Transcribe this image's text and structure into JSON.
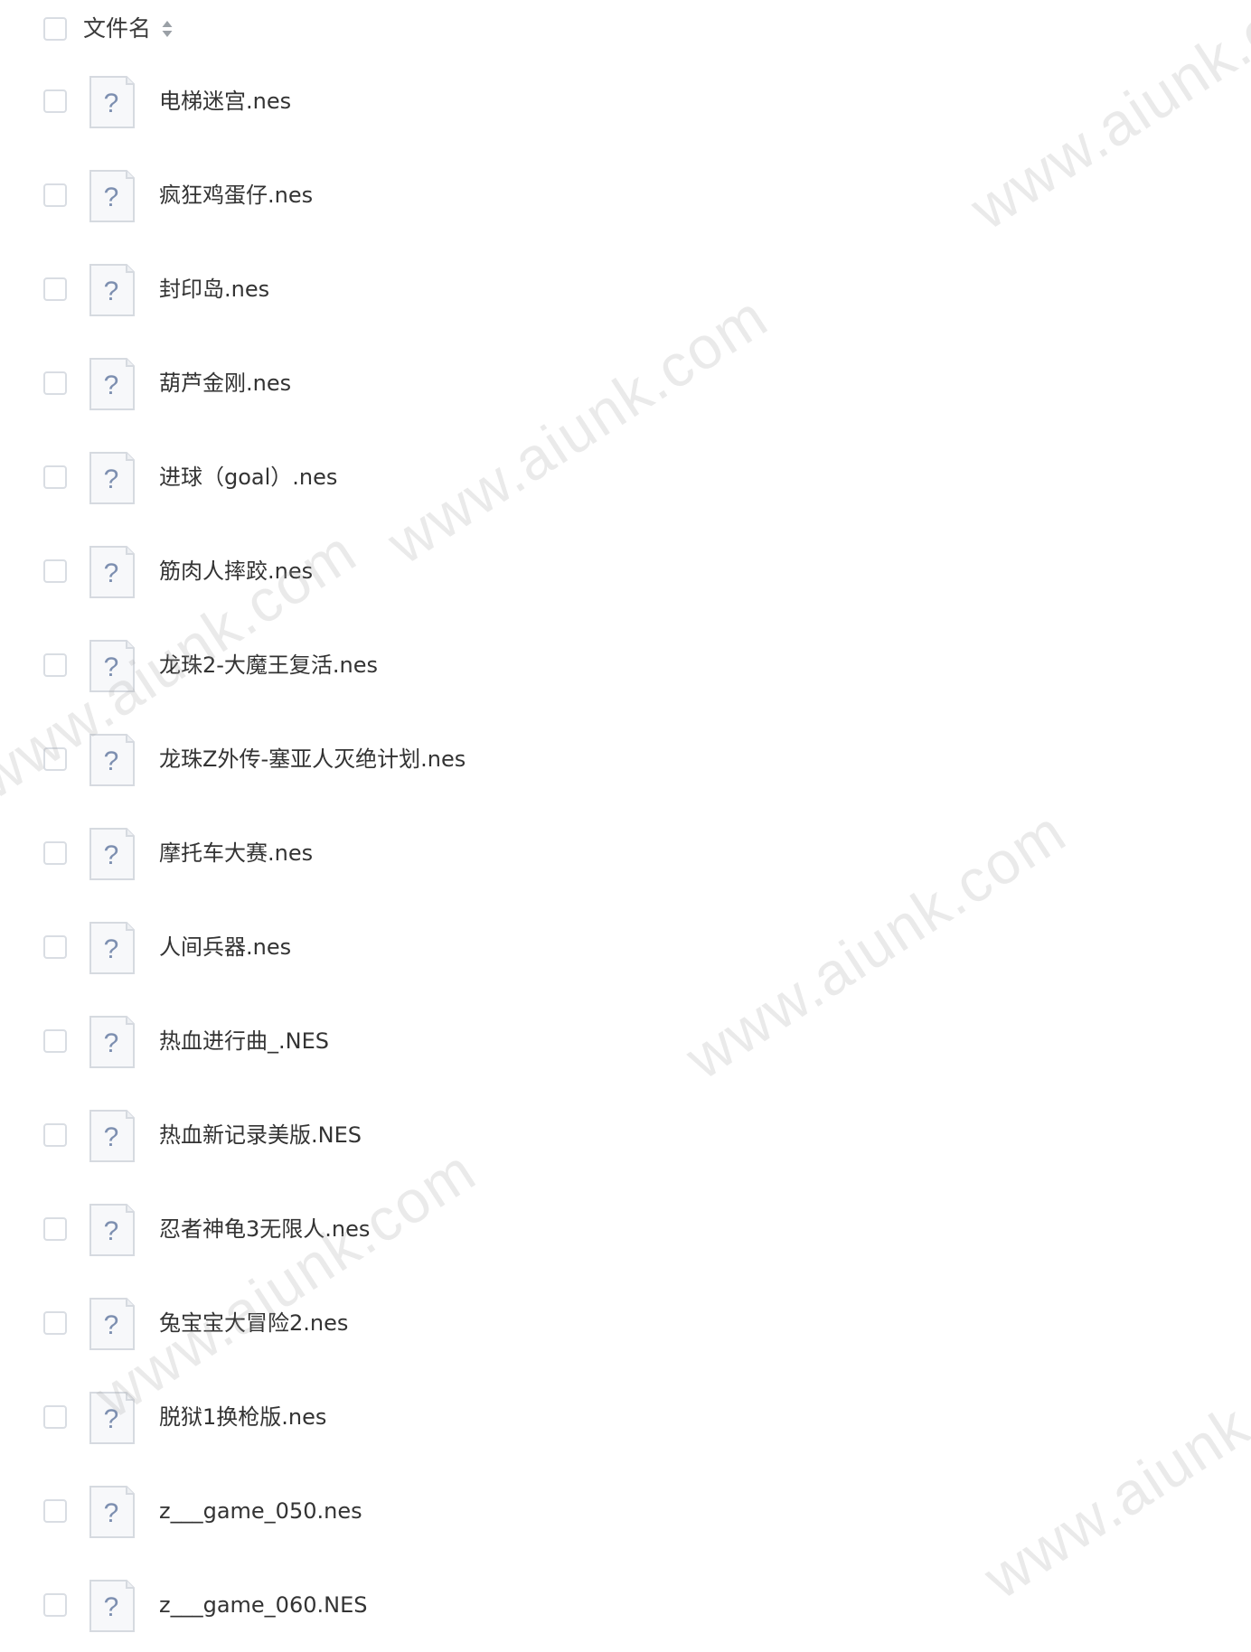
{
  "header": {
    "column_label": "文件名",
    "sort_icon": "sort-updown-icon"
  },
  "files": [
    {
      "name": "电梯迷宫.nes",
      "icon": "unknown-file-icon"
    },
    {
      "name": "疯狂鸡蛋仔.nes",
      "icon": "unknown-file-icon"
    },
    {
      "name": "封印岛.nes",
      "icon": "unknown-file-icon"
    },
    {
      "name": "葫芦金刚.nes",
      "icon": "unknown-file-icon"
    },
    {
      "name": "进球（goal）.nes",
      "icon": "unknown-file-icon"
    },
    {
      "name": "筋肉人摔跤.nes",
      "icon": "unknown-file-icon"
    },
    {
      "name": "龙珠2-大魔王复活.nes",
      "icon": "unknown-file-icon"
    },
    {
      "name": "龙珠Z外传-塞亚人灭绝计划.nes",
      "icon": "unknown-file-icon"
    },
    {
      "name": "摩托车大赛.nes",
      "icon": "unknown-file-icon"
    },
    {
      "name": "人间兵器.nes",
      "icon": "unknown-file-icon"
    },
    {
      "name": "热血进行曲_.NES",
      "icon": "unknown-file-icon"
    },
    {
      "name": "热血新记录美版.NES",
      "icon": "unknown-file-icon"
    },
    {
      "name": "忍者神龟3无限人.nes",
      "icon": "unknown-file-icon"
    },
    {
      "name": "兔宝宝大冒险2.nes",
      "icon": "unknown-file-icon"
    },
    {
      "name": "脱狱1换枪版.nes",
      "icon": "unknown-file-icon"
    },
    {
      "name": "z___game_050.nes",
      "icon": "unknown-file-icon"
    },
    {
      "name": "z___game_060.NES",
      "icon": "unknown-file-icon"
    }
  ],
  "watermark": {
    "text": "www.aiunk.com"
  }
}
